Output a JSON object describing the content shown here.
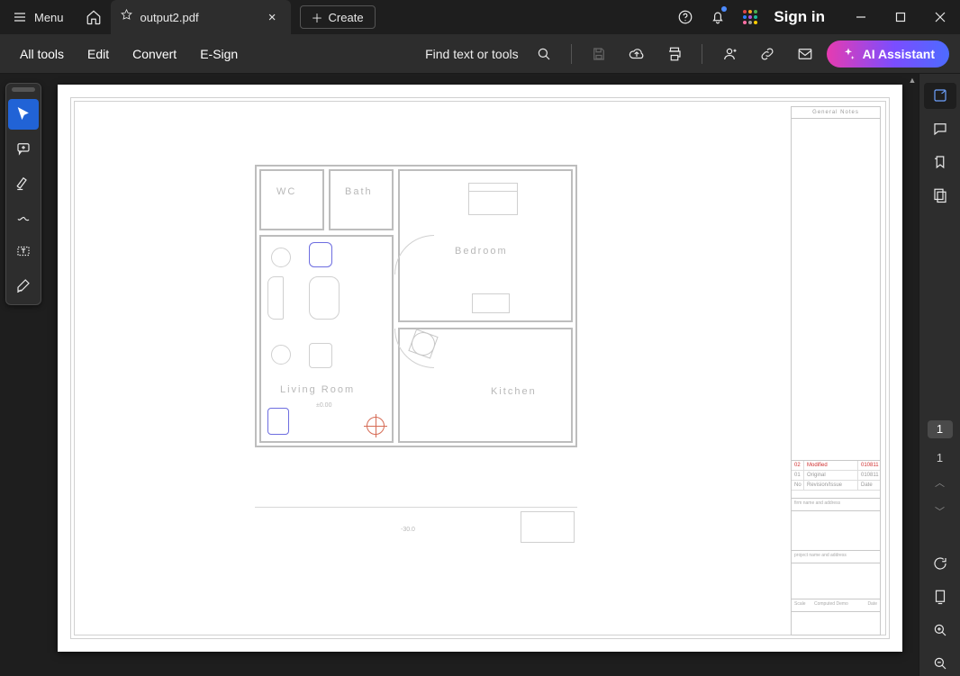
{
  "titlebar": {
    "menu_label": "Menu",
    "tab_title": "output2.pdf",
    "create_label": "Create",
    "signin_label": "Sign in"
  },
  "toolbar": {
    "all_tools": "All tools",
    "edit": "Edit",
    "convert": "Convert",
    "esign": "E-Sign",
    "find_label": "Find text or tools",
    "ai_label": "AI Assistant"
  },
  "apps_colors": [
    "#e04646",
    "#f5a623",
    "#4caf50",
    "#2e7dff",
    "#b552d6",
    "#1abc9c",
    "#ff6fa5",
    "#9e9e9e",
    "#ffcc00"
  ],
  "document": {
    "rooms": {
      "wc": "WC",
      "bath": "Bath",
      "bedroom": "Bedroom",
      "living": "Living  Room",
      "kitchen": "Kitchen"
    },
    "level_mark": "±0.00",
    "outside_mark": "-30.0",
    "notes_header": "General Notes",
    "revisions": [
      {
        "no": "02",
        "desc": "Modified",
        "date": "010811",
        "hot": true
      },
      {
        "no": "01",
        "desc": "Original",
        "date": "010811",
        "hot": false
      }
    ],
    "rev_header": {
      "no": "No",
      "desc": "Revision/Issue",
      "date": "Date"
    },
    "firm_label": "firm name and address",
    "project_label": "project name and address",
    "scale_label": "Scale",
    "scale_value": "Computed Demo",
    "date_label": "Date"
  },
  "nav": {
    "current_page": "1",
    "total_pages": "1"
  }
}
